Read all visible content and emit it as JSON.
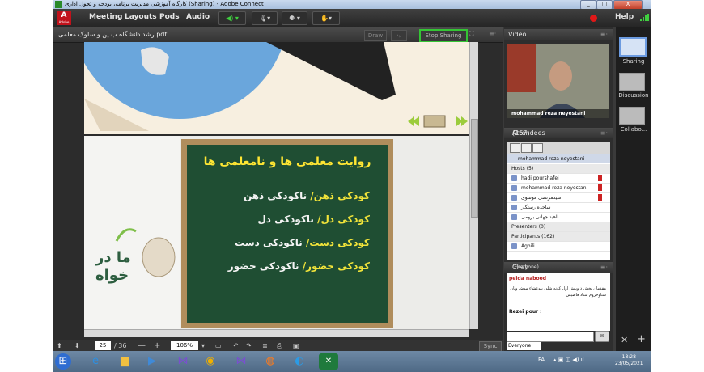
{
  "window": {
    "title": "کارگاه آموزشی مدیریت برنامه، بودجه و تحول اداری (Sharing) - Adobe Connect",
    "minimize": "_",
    "maximize": "□",
    "close": "X"
  },
  "menubar": {
    "logo_text": "A",
    "logo_sub": "Adobe",
    "items": [
      "Meeting",
      "Layouts",
      "Pods",
      "Audio"
    ],
    "help": "Help"
  },
  "share_pod": {
    "file_name": "رشد‌ دانشگاه ب ین و سلوک معلمی.pdf",
    "draw_button": "Draw",
    "stop_sharing": "Stop Sharing",
    "menu": "≡·"
  },
  "slide": {
    "title": "روایت معلمی ها و نامعلمی ها",
    "lines": [
      {
        "yellow": "کودکی ذهن/",
        "white": "ناکودکی ذهن"
      },
      {
        "yellow": "کودکی دل/",
        "white": "ناکودکی دل"
      },
      {
        "yellow": "کودکی دست/",
        "white": "ناکودکی دست"
      },
      {
        "yellow": "کودکی حضور/",
        "white": "ناکودکی حضور"
      }
    ],
    "side_text_1": "ما در",
    "side_text_2": "خواه"
  },
  "bottom_toolbar": {
    "page_current": "25",
    "page_total": "/ 36",
    "zoom": "106%",
    "sync": "Sync"
  },
  "video_pod": {
    "title": "Video",
    "participants_count": "(1)",
    "caption": "mohammad reza neyestani"
  },
  "attendees_pod": {
    "title": "Attendees",
    "count": "(167)",
    "me": "mohammad reza neyestani",
    "hosts_header": "Hosts (5)",
    "hosts": [
      "hadi pourshafei",
      "mohammad reza neyestani",
      "سیدمرتضی موسوی",
      "ساجده رستگار",
      "ناهید جهانی برومی"
    ],
    "presenters_header": "Presenters (0)",
    "participants_header": "Participants (162)",
    "participants": [
      "Aghili"
    ]
  },
  "chat_pod": {
    "title": "Chat 3",
    "scope": "(Everyone)",
    "messages": [
      {
        "sender": "peida nabood",
        "text": "مقدمان بخش د ویپش اول کونه شلی بیوعشاء موش ویان شتاوخروم ستاد قاضیس"
      },
      {
        "sender": "Rezei pour",
        "text": ":"
      }
    ],
    "tab": "Everyone"
  },
  "layouts": [
    "Sharing",
    "Discussion",
    "Collabo..."
  ],
  "taskbar": {
    "lang": "FA",
    "time": "18:28",
    "date": "23/05/2021"
  },
  "colors": {
    "accent_green": "#34c534",
    "record_red": "#e01818",
    "board_green": "#1f4e33",
    "chalk_yellow": "#f2e43a"
  }
}
